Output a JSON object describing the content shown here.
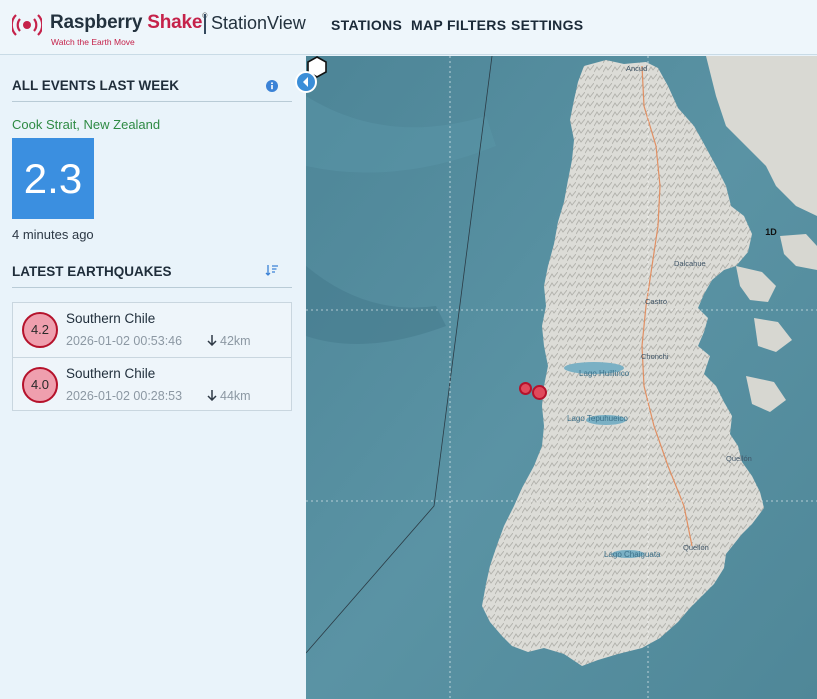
{
  "header": {
    "brand_name": "Raspberry",
    "brand_accent": "Shake",
    "brand_reg": "®",
    "tagline": "Watch the Earth Move",
    "app_name": "StationView",
    "nav": [
      "STATIONS",
      "MAP FILTERS",
      "SETTINGS"
    ]
  },
  "sidebar": {
    "title": "ALL EVENTS LAST WEEK",
    "latest_event": {
      "location": "Cook Strait, New Zealand",
      "magnitude": "2.3",
      "ago": "4 minutes ago"
    },
    "latest_title": "LATEST EARTHQUAKES",
    "quakes": [
      {
        "magnitude": "4.2",
        "place": "Southern Chile",
        "time": "2026-01-02 00:53:46",
        "depth": "42km"
      },
      {
        "magnitude": "4.0",
        "place": "Southern Chile",
        "time": "2026-01-02 00:28:53",
        "depth": "44km"
      }
    ]
  },
  "map": {
    "station_label": "1D",
    "labels": {
      "ancud": "Ancud",
      "dalcahue": "Dalcahue",
      "castro": "Castro",
      "chonchi": "Chonchi",
      "lake_huillinco": "Lago Huillinco",
      "lake_tepuhueico": "Lago Tepuhueico",
      "quellon_n": "Quellón",
      "lake_chaiguata": "Lago Chaiguata",
      "quellon": "Quellón"
    }
  },
  "icons": {
    "logo": "raspberry-shake-logo-icon",
    "info": "info-icon",
    "collapse": "chevron-left-icon",
    "sort": "sort-icon",
    "depth_arrow": "arrow-down-icon",
    "station": "hexagon-station-icon"
  },
  "colors": {
    "brand": "#c5224a",
    "accent_blue": "#3b8fe0",
    "location_green": "#2e8a43",
    "quake_fill": "#ef9fae",
    "quake_border": "#b5122b"
  }
}
